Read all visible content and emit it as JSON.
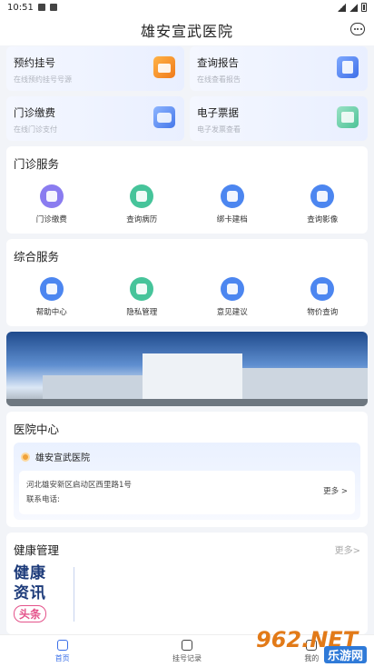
{
  "status": {
    "time": "10:51"
  },
  "header": {
    "title": "雄安宣武医院"
  },
  "cards": [
    {
      "title": "预约挂号",
      "sub": "在线预约挂号号源",
      "icon": "calendar-icon"
    },
    {
      "title": "查询报告",
      "sub": "在线查看报告",
      "icon": "report-icon"
    },
    {
      "title": "门诊缴费",
      "sub": "在线门诊支付",
      "icon": "wallet-icon"
    },
    {
      "title": "电子票据",
      "sub": "电子发票查看",
      "icon": "invoice-icon"
    }
  ],
  "outpatient": {
    "title": "门诊服务",
    "items": [
      {
        "label": "门诊缴费",
        "icon": "payment-icon",
        "color": "#8a7cf0"
      },
      {
        "label": "查询病历",
        "icon": "record-icon",
        "color": "#46c49a"
      },
      {
        "label": "绑卡建档",
        "icon": "card-icon",
        "color": "#4c86f0"
      },
      {
        "label": "查询影像",
        "icon": "film-icon",
        "color": "#4c86f0"
      }
    ]
  },
  "general": {
    "title": "综合服务",
    "items": [
      {
        "label": "帮助中心",
        "icon": "help-icon",
        "color": "#4c86f0"
      },
      {
        "label": "隐私管理",
        "icon": "shield-icon",
        "color": "#46c49a"
      },
      {
        "label": "意见建议",
        "icon": "feedback-icon",
        "color": "#4c86f0"
      },
      {
        "label": "物价查询",
        "icon": "price-icon",
        "color": "#4c86f0"
      }
    ]
  },
  "hospital": {
    "title": "医院中心",
    "name": "雄安宣武医院",
    "address": "河北雄安新区启动区西里路1号",
    "phone_label": "联系电话:",
    "more": "更多 >"
  },
  "health": {
    "title": "健康管理",
    "more": "更多>",
    "news_line1": "健康",
    "news_line2": "资讯",
    "news_tag": "头条"
  },
  "tabs": [
    {
      "label": "首页",
      "active": true
    },
    {
      "label": "挂号记录",
      "active": false
    },
    {
      "label": "我的",
      "active": false
    }
  ],
  "watermark": {
    "number": "962.NET",
    "sub": "乐游网"
  }
}
